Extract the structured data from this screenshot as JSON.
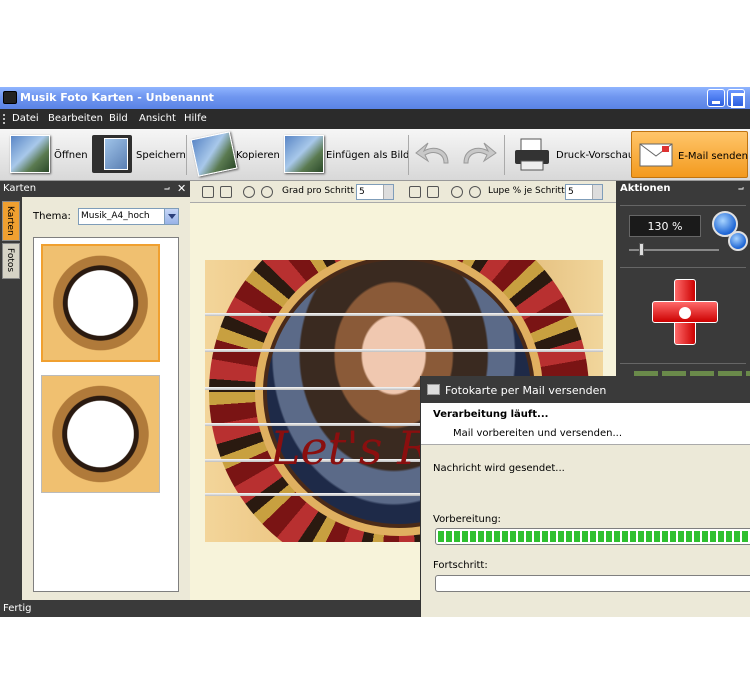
{
  "window": {
    "title": "Musik Foto Karten - Unbenannt"
  },
  "menu": [
    "Datei",
    "Bearbeiten",
    "Bild",
    "Ansicht",
    "Hilfe"
  ],
  "toolbar": {
    "open_label": "Öffnen",
    "save_label": "Speichern",
    "copy_label": "Kopieren",
    "paste_label": "Einfügen als Bild",
    "print_preview_label": "Druck-Vorschau",
    "email_label": "E-Mail senden"
  },
  "left_panel": {
    "title": "Karten",
    "tabs": [
      "Karten",
      "Fotos"
    ],
    "thema_label": "Thema:",
    "thema_value": "Musik_A4_hoch"
  },
  "canvas_toolbar": {
    "grad_label": "Grad pro Schritt",
    "grad_value": "5",
    "lupe_label": "Lupe % je Schritt",
    "lupe_value": "5"
  },
  "card": {
    "text": "Let's R"
  },
  "right_panel": {
    "title": "Aktionen",
    "zoom_value": "130 %"
  },
  "status": {
    "text": "Fertig"
  },
  "dialog": {
    "title": "Fotokarte per Mail versenden",
    "heading": "Verarbeitung läuft...",
    "subheading": "Mail vorbereiten und versenden...",
    "message": "Nachricht wird gesendet...",
    "prep_label": "Vorbereitung:",
    "prep_progress": 1.0,
    "progress_label": "Fortschritt:",
    "progress_value": 0.0
  },
  "colors": {
    "titlebar": "#6f96ef",
    "dark_panel": "#3a3a3a",
    "email_button": "#f39a1e",
    "progress_green": "#2fc02f",
    "overlay_text": "#8a0f0f"
  }
}
